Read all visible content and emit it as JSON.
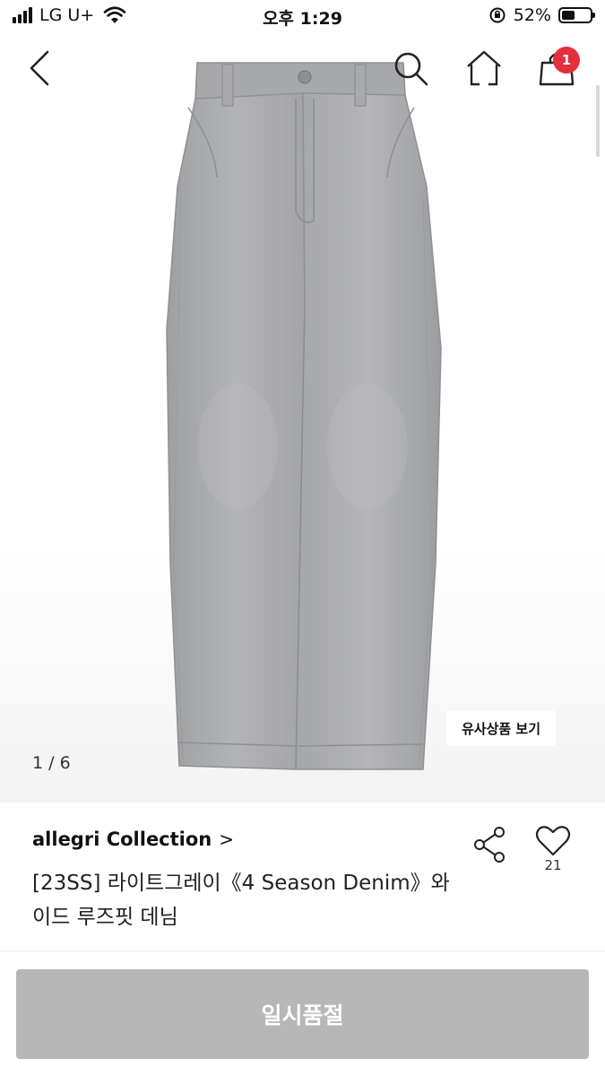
{
  "status_bar": {
    "carrier": "LG U+",
    "time": "오후 1:29",
    "battery_percent": "52%",
    "battery_level": 0.52
  },
  "nav": {
    "cart_count": "1"
  },
  "gallery": {
    "counter": "1 / 6",
    "similar_button_label": "유사상품 보기"
  },
  "product": {
    "brand": "allegri Collection",
    "brand_arrow": ">",
    "title_line1": "[23SS] 라이트그레이《4 Season Denim》와",
    "title_line2": "이드 루즈핏 데님",
    "like_count": "21"
  },
  "bottom": {
    "soldout_label": "일시품절"
  },
  "colors": {
    "badge": "#e3303d",
    "soldout_button": "#b7b7b7",
    "denim": "#a9aaab"
  },
  "icons": [
    "signal-icon",
    "wifi-icon",
    "orientation-lock-icon",
    "battery-icon",
    "back-icon",
    "search-icon",
    "home-icon",
    "cart-icon",
    "share-icon",
    "heart-icon"
  ]
}
